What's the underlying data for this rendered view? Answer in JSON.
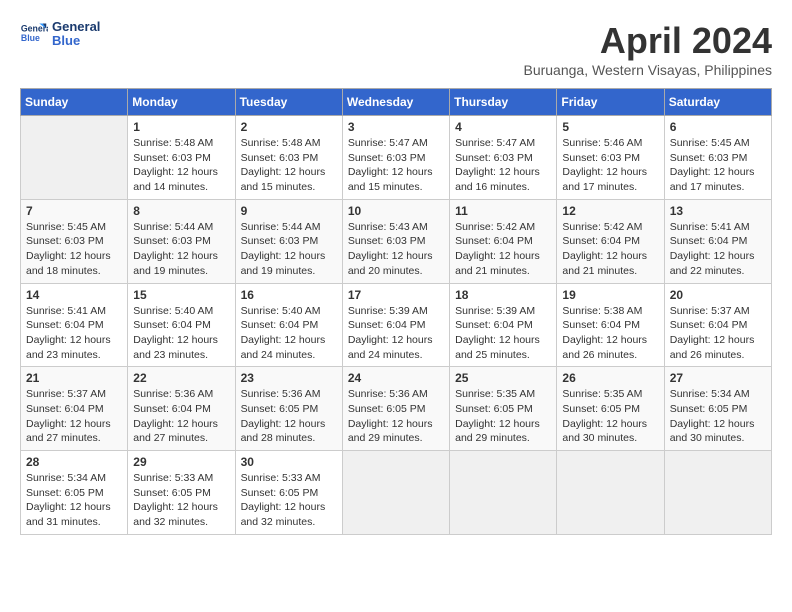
{
  "header": {
    "logo_line1": "General",
    "logo_line2": "Blue",
    "month_title": "April 2024",
    "subtitle": "Buruanga, Western Visayas, Philippines"
  },
  "days_of_week": [
    "Sunday",
    "Monday",
    "Tuesday",
    "Wednesday",
    "Thursday",
    "Friday",
    "Saturday"
  ],
  "weeks": [
    [
      {
        "day": "",
        "info": ""
      },
      {
        "day": "1",
        "info": "Sunrise: 5:48 AM\nSunset: 6:03 PM\nDaylight: 12 hours\nand 14 minutes."
      },
      {
        "day": "2",
        "info": "Sunrise: 5:48 AM\nSunset: 6:03 PM\nDaylight: 12 hours\nand 15 minutes."
      },
      {
        "day": "3",
        "info": "Sunrise: 5:47 AM\nSunset: 6:03 PM\nDaylight: 12 hours\nand 15 minutes."
      },
      {
        "day": "4",
        "info": "Sunrise: 5:47 AM\nSunset: 6:03 PM\nDaylight: 12 hours\nand 16 minutes."
      },
      {
        "day": "5",
        "info": "Sunrise: 5:46 AM\nSunset: 6:03 PM\nDaylight: 12 hours\nand 17 minutes."
      },
      {
        "day": "6",
        "info": "Sunrise: 5:45 AM\nSunset: 6:03 PM\nDaylight: 12 hours\nand 17 minutes."
      }
    ],
    [
      {
        "day": "7",
        "info": "Sunrise: 5:45 AM\nSunset: 6:03 PM\nDaylight: 12 hours\nand 18 minutes."
      },
      {
        "day": "8",
        "info": "Sunrise: 5:44 AM\nSunset: 6:03 PM\nDaylight: 12 hours\nand 19 minutes."
      },
      {
        "day": "9",
        "info": "Sunrise: 5:44 AM\nSunset: 6:03 PM\nDaylight: 12 hours\nand 19 minutes."
      },
      {
        "day": "10",
        "info": "Sunrise: 5:43 AM\nSunset: 6:03 PM\nDaylight: 12 hours\nand 20 minutes."
      },
      {
        "day": "11",
        "info": "Sunrise: 5:42 AM\nSunset: 6:04 PM\nDaylight: 12 hours\nand 21 minutes."
      },
      {
        "day": "12",
        "info": "Sunrise: 5:42 AM\nSunset: 6:04 PM\nDaylight: 12 hours\nand 21 minutes."
      },
      {
        "day": "13",
        "info": "Sunrise: 5:41 AM\nSunset: 6:04 PM\nDaylight: 12 hours\nand 22 minutes."
      }
    ],
    [
      {
        "day": "14",
        "info": "Sunrise: 5:41 AM\nSunset: 6:04 PM\nDaylight: 12 hours\nand 23 minutes."
      },
      {
        "day": "15",
        "info": "Sunrise: 5:40 AM\nSunset: 6:04 PM\nDaylight: 12 hours\nand 23 minutes."
      },
      {
        "day": "16",
        "info": "Sunrise: 5:40 AM\nSunset: 6:04 PM\nDaylight: 12 hours\nand 24 minutes."
      },
      {
        "day": "17",
        "info": "Sunrise: 5:39 AM\nSunset: 6:04 PM\nDaylight: 12 hours\nand 24 minutes."
      },
      {
        "day": "18",
        "info": "Sunrise: 5:39 AM\nSunset: 6:04 PM\nDaylight: 12 hours\nand 25 minutes."
      },
      {
        "day": "19",
        "info": "Sunrise: 5:38 AM\nSunset: 6:04 PM\nDaylight: 12 hours\nand 26 minutes."
      },
      {
        "day": "20",
        "info": "Sunrise: 5:37 AM\nSunset: 6:04 PM\nDaylight: 12 hours\nand 26 minutes."
      }
    ],
    [
      {
        "day": "21",
        "info": "Sunrise: 5:37 AM\nSunset: 6:04 PM\nDaylight: 12 hours\nand 27 minutes."
      },
      {
        "day": "22",
        "info": "Sunrise: 5:36 AM\nSunset: 6:04 PM\nDaylight: 12 hours\nand 27 minutes."
      },
      {
        "day": "23",
        "info": "Sunrise: 5:36 AM\nSunset: 6:05 PM\nDaylight: 12 hours\nand 28 minutes."
      },
      {
        "day": "24",
        "info": "Sunrise: 5:36 AM\nSunset: 6:05 PM\nDaylight: 12 hours\nand 29 minutes."
      },
      {
        "day": "25",
        "info": "Sunrise: 5:35 AM\nSunset: 6:05 PM\nDaylight: 12 hours\nand 29 minutes."
      },
      {
        "day": "26",
        "info": "Sunrise: 5:35 AM\nSunset: 6:05 PM\nDaylight: 12 hours\nand 30 minutes."
      },
      {
        "day": "27",
        "info": "Sunrise: 5:34 AM\nSunset: 6:05 PM\nDaylight: 12 hours\nand 30 minutes."
      }
    ],
    [
      {
        "day": "28",
        "info": "Sunrise: 5:34 AM\nSunset: 6:05 PM\nDaylight: 12 hours\nand 31 minutes."
      },
      {
        "day": "29",
        "info": "Sunrise: 5:33 AM\nSunset: 6:05 PM\nDaylight: 12 hours\nand 32 minutes."
      },
      {
        "day": "30",
        "info": "Sunrise: 5:33 AM\nSunset: 6:05 PM\nDaylight: 12 hours\nand 32 minutes."
      },
      {
        "day": "",
        "info": ""
      },
      {
        "day": "",
        "info": ""
      },
      {
        "day": "",
        "info": ""
      },
      {
        "day": "",
        "info": ""
      }
    ]
  ]
}
